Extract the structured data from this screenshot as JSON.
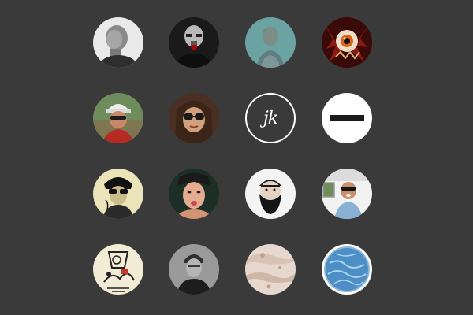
{
  "logo_text": "jk",
  "colors": {
    "background": "#3a3a3a",
    "white": "#ffffff",
    "teal": "#6ba3a3"
  },
  "avatars": [
    {
      "name": "avatar-bald-man-profile"
    },
    {
      "name": "avatar-bald-man-glasses"
    },
    {
      "name": "avatar-man-teal-background"
    },
    {
      "name": "avatar-eyeball-monster"
    },
    {
      "name": "avatar-man-cap-sunglasses"
    },
    {
      "name": "avatar-woman-sunglasses"
    },
    {
      "name": "avatar-jk-logo"
    },
    {
      "name": "avatar-minus-icon"
    },
    {
      "name": "avatar-woman-sunglasses-illustration"
    },
    {
      "name": "avatar-woman-pouting"
    },
    {
      "name": "avatar-bearded-man-illustration"
    },
    {
      "name": "avatar-man-in-car"
    },
    {
      "name": "avatar-sketch-illustration"
    },
    {
      "name": "avatar-man-gray"
    },
    {
      "name": "avatar-pale-texture"
    },
    {
      "name": "avatar-blue-texture"
    }
  ]
}
